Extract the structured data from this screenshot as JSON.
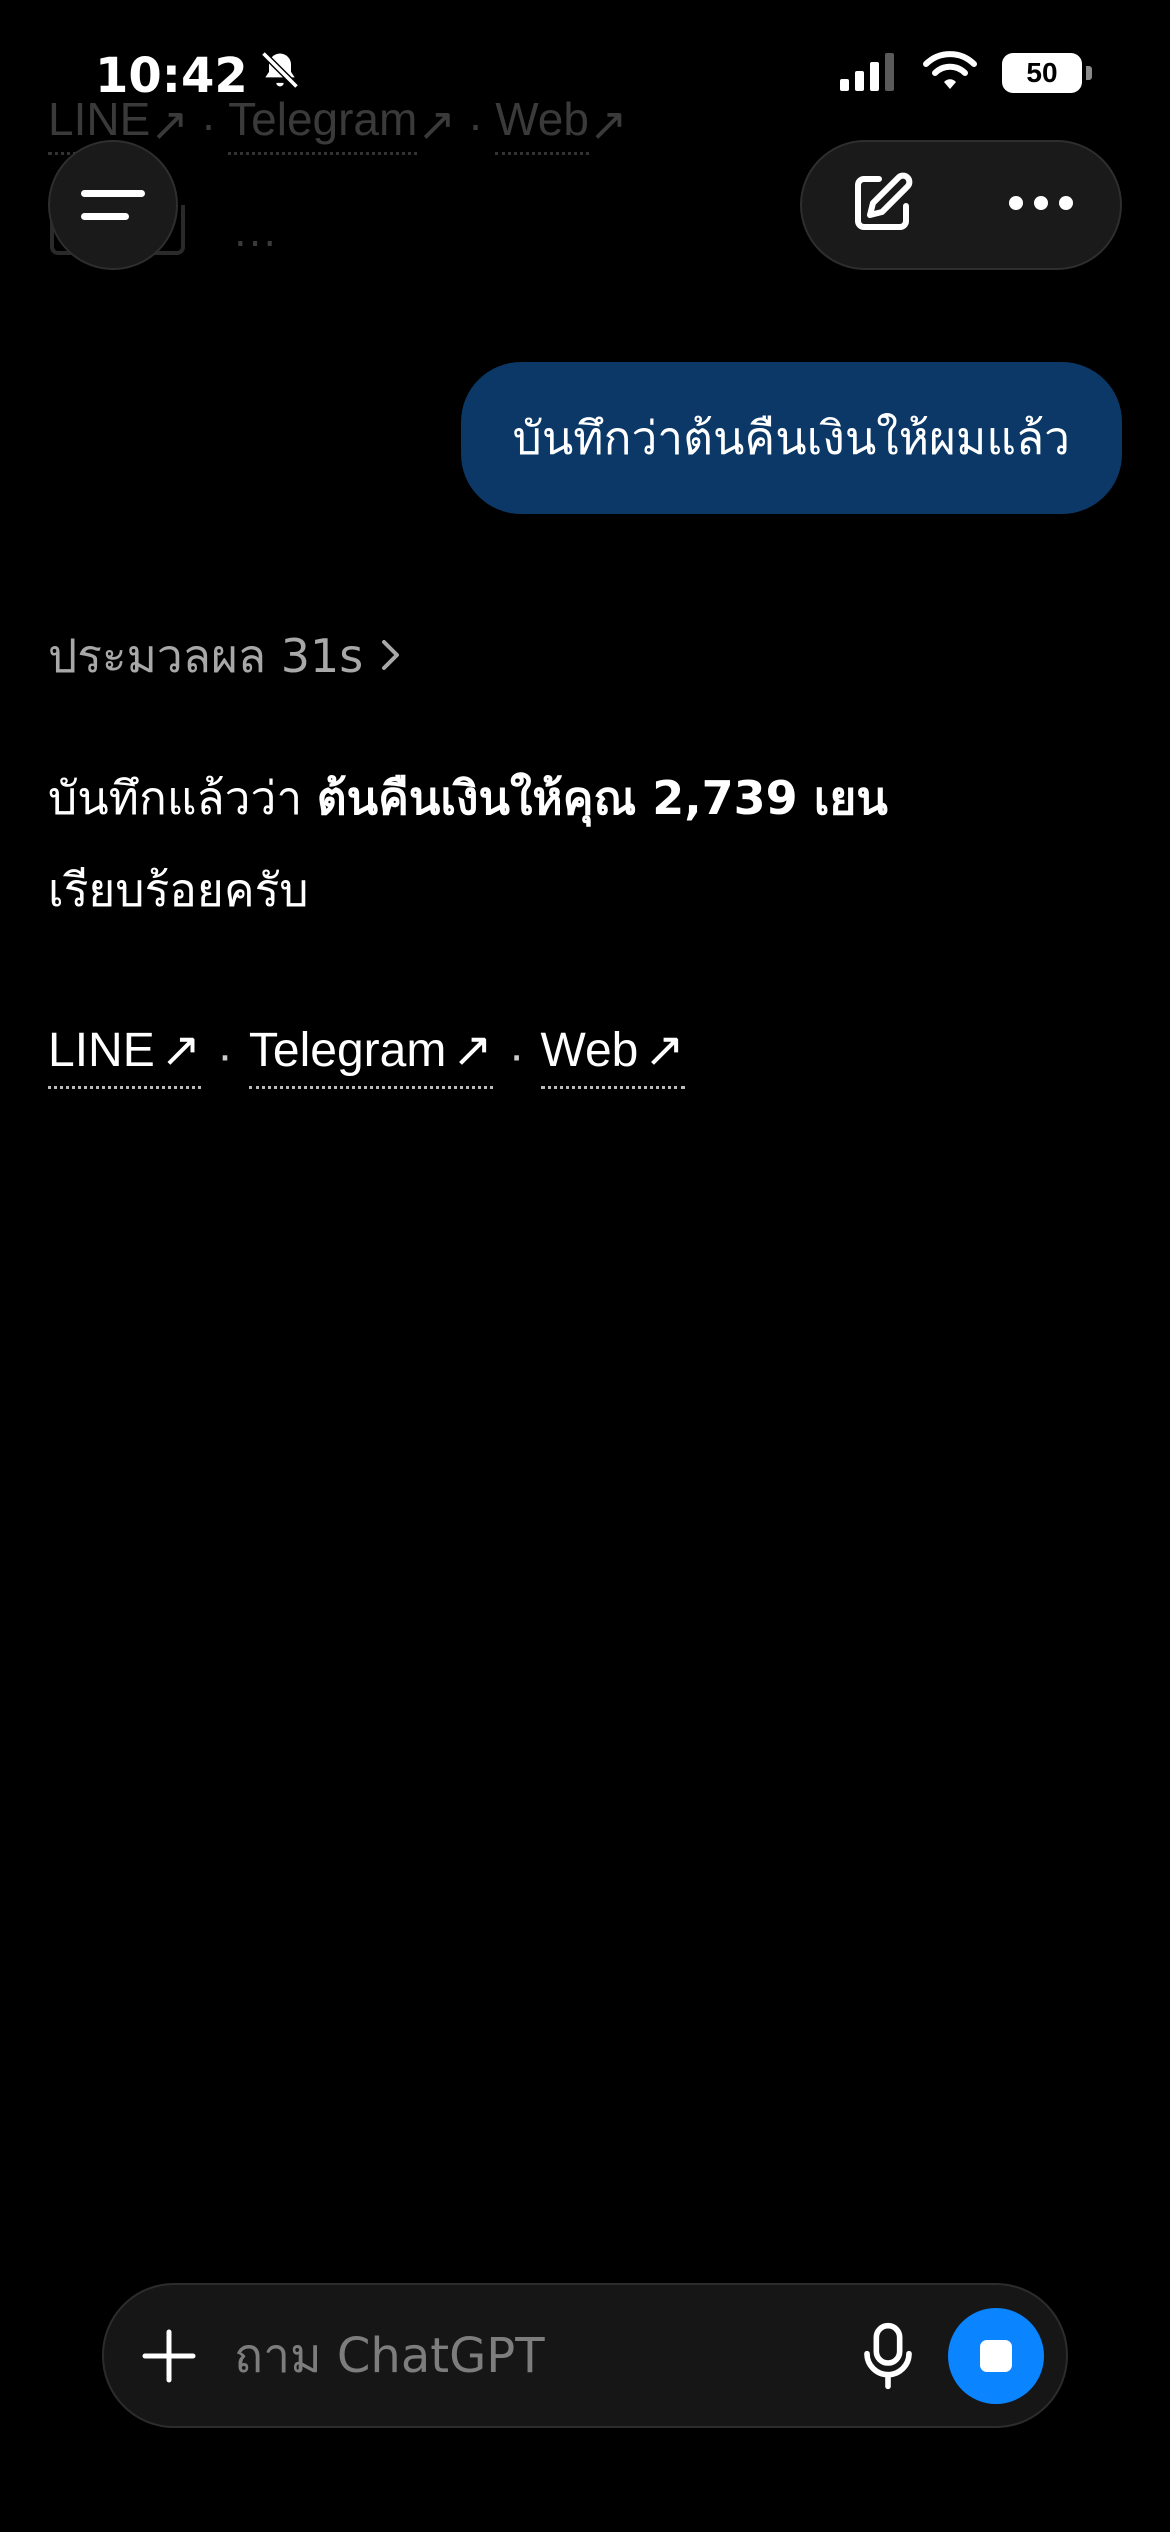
{
  "status_bar": {
    "time": "10:42",
    "battery": "50",
    "icons": [
      "bell-slash-icon",
      "signal-icon",
      "wifi-icon",
      "battery-icon"
    ]
  },
  "ghost": {
    "links": [
      "LINE",
      "Telegram",
      "Web"
    ],
    "dots": "..."
  },
  "header": {
    "icons": [
      "menu-icon",
      "new-chat-icon",
      "more-icon"
    ]
  },
  "user_message": {
    "text": "บันทึกว่าต้นคืนเงินให้ผมแล้ว"
  },
  "thinking": {
    "label": "ประมวลผล 31s"
  },
  "assistant_message": {
    "prefix": "บันทึกแล้วว่า ",
    "bold": "ต้นคืนเงินให้คุณ 2,739 เยน",
    "line2": "เรียบร้อยครับ"
  },
  "links": {
    "items": [
      "LINE",
      "Telegram",
      "Web"
    ],
    "separator": "·"
  },
  "composer": {
    "placeholder": "ถาม ChatGPT"
  },
  "colors": {
    "background": "#000000",
    "user_bubble": "#0b3866",
    "stop_button": "#0a84ff"
  }
}
